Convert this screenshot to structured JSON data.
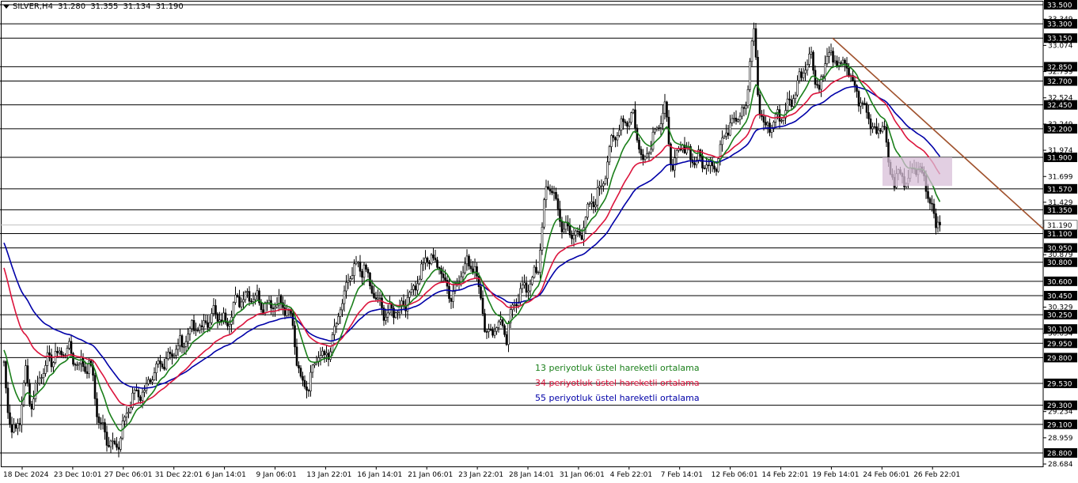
{
  "header": {
    "symbol": "SILVER,H4",
    "open": "31.280",
    "high": "31.355",
    "low": "31.134",
    "close": "31.190"
  },
  "legend": {
    "ema13": "13 periyotluk üstel hareketli ortalama",
    "ema34": "34 periyotluk üstel hareketli ortalama",
    "ema55": "55 periyotluk üstel hareketli ortalama"
  },
  "colors": {
    "ema13": "#1a7f1a",
    "ema34": "#dc143c",
    "ema55": "#0000a8",
    "trendline": "#a0522d",
    "zone": "#d8bfd8",
    "candle": "#000000",
    "level": "#000000",
    "current": "#c0c0c0"
  },
  "chart_data": {
    "type": "candlestick",
    "ylim": [
      28.684,
      33.5
    ],
    "x_labels": [
      "18 Dec 2024",
      "23 Dec 10:01",
      "27 Dec 06:01",
      "31 Dec 22:01",
      "6 Jan 14:01",
      "9 Jan 06:01",
      "13 Jan 22:01",
      "16 Jan 14:01",
      "21 Jan 06:01",
      "23 Jan 22:01",
      "28 Jan 14:01",
      "31 Jan 06:01",
      "4 Feb 22:01",
      "7 Feb 14:01",
      "12 Feb 06:01",
      "14 Feb 22:01",
      "19 Feb 14:01",
      "24 Feb 06:01",
      "26 Feb 22:01"
    ],
    "y_ticks": [
      "33.500",
      "33.349",
      "33.150",
      "33.074",
      "32.850",
      "32.799",
      "32.700",
      "32.524",
      "32.450",
      "32.249",
      "32.200",
      "31.974",
      "31.900",
      "31.699",
      "31.570",
      "31.429",
      "31.350",
      "31.190",
      "31.100",
      "30.950",
      "30.879",
      "30.800",
      "30.600",
      "30.450",
      "30.329",
      "30.250",
      "30.100",
      "30.054",
      "29.950",
      "29.800",
      "29.530",
      "29.300",
      "29.234",
      "29.100",
      "28.959",
      "28.800",
      "28.684"
    ],
    "levels": [
      33.5,
      33.3,
      33.15,
      32.85,
      32.7,
      32.45,
      32.2,
      31.9,
      31.57,
      31.35,
      31.1,
      30.95,
      30.8,
      30.6,
      30.45,
      30.25,
      30.1,
      29.95,
      29.8,
      29.53,
      29.3,
      29.1,
      28.8
    ],
    "level_labels": [
      "33.500",
      "33.300",
      "33.150",
      "32.850",
      "32.700",
      "32.450",
      "32.200",
      "31.900",
      "31.570",
      "31.350",
      "31.100",
      "30.950",
      "30.800",
      "30.600",
      "30.450",
      "30.250",
      "30.100",
      "29.950",
      "29.800",
      "29.530",
      "29.300",
      "29.100",
      "28.800"
    ],
    "current_price": 31.19,
    "current_label": "31.190",
    "anchors": [
      [
        0,
        30.15
      ],
      [
        8,
        29.4
      ],
      [
        15,
        28.95
      ],
      [
        25,
        29.15
      ],
      [
        32,
        29.7
      ],
      [
        40,
        29.35
      ],
      [
        50,
        29.6
      ],
      [
        65,
        29.75
      ],
      [
        85,
        29.95
      ],
      [
        100,
        29.7
      ],
      [
        115,
        29.65
      ],
      [
        125,
        29.15
      ],
      [
        140,
        28.95
      ],
      [
        150,
        28.85
      ],
      [
        158,
        29.1
      ],
      [
        168,
        29.4
      ],
      [
        180,
        29.5
      ],
      [
        195,
        29.6
      ],
      [
        210,
        29.75
      ],
      [
        225,
        29.95
      ],
      [
        240,
        30.1
      ],
      [
        255,
        30.05
      ],
      [
        270,
        30.3
      ],
      [
        285,
        30.2
      ],
      [
        300,
        30.35
      ],
      [
        320,
        30.5
      ],
      [
        340,
        30.35
      ],
      [
        360,
        30.3
      ],
      [
        370,
        30.2
      ],
      [
        378,
        29.65
      ],
      [
        390,
        29.5
      ],
      [
        400,
        29.75
      ],
      [
        415,
        29.85
      ],
      [
        430,
        30.35
      ],
      [
        445,
        30.65
      ],
      [
        460,
        30.75
      ],
      [
        475,
        30.45
      ],
      [
        490,
        30.2
      ],
      [
        505,
        30.3
      ],
      [
        520,
        30.55
      ],
      [
        540,
        30.8
      ],
      [
        555,
        30.75
      ],
      [
        570,
        30.5
      ],
      [
        585,
        30.7
      ],
      [
        600,
        30.75
      ],
      [
        615,
        30.1
      ],
      [
        630,
        30.15
      ],
      [
        640,
        29.95
      ],
      [
        650,
        30.4
      ],
      [
        665,
        30.6
      ],
      [
        680,
        30.7
      ],
      [
        690,
        31.55
      ],
      [
        700,
        31.5
      ],
      [
        712,
        31.2
      ],
      [
        725,
        31.1
      ],
      [
        735,
        31.05
      ],
      [
        745,
        31.35
      ],
      [
        760,
        31.65
      ],
      [
        770,
        32.0
      ],
      [
        785,
        32.2
      ],
      [
        800,
        32.35
      ],
      [
        812,
        31.9
      ],
      [
        825,
        32.1
      ],
      [
        840,
        32.35
      ],
      [
        850,
        31.8
      ],
      [
        862,
        32.1
      ],
      [
        875,
        31.85
      ],
      [
        890,
        31.8
      ],
      [
        905,
        31.9
      ],
      [
        915,
        32.15
      ],
      [
        930,
        32.3
      ],
      [
        942,
        32.4
      ],
      [
        948,
        33.0
      ],
      [
        952,
        33.3
      ],
      [
        958,
        32.55
      ],
      [
        966,
        32.2
      ],
      [
        975,
        32.2
      ],
      [
        990,
        32.35
      ],
      [
        1005,
        32.65
      ],
      [
        1015,
        32.85
      ],
      [
        1025,
        32.9
      ],
      [
        1035,
        32.55
      ],
      [
        1045,
        33.05
      ],
      [
        1052,
        32.95
      ],
      [
        1060,
        32.9
      ],
      [
        1068,
        32.85
      ],
      [
        1078,
        32.6
      ],
      [
        1090,
        32.45
      ],
      [
        1100,
        32.35
      ],
      [
        1108,
        32.15
      ],
      [
        1115,
        32.3
      ],
      [
        1122,
        31.8
      ],
      [
        1130,
        31.6
      ],
      [
        1138,
        31.75
      ],
      [
        1146,
        31.7
      ],
      [
        1155,
        31.85
      ],
      [
        1163,
        31.75
      ],
      [
        1170,
        31.6
      ],
      [
        1175,
        31.35
      ],
      [
        1182,
        31.25
      ],
      [
        1188,
        31.19
      ]
    ],
    "series": [
      {
        "name": "13 periyotluk üstel hareketli ortalama",
        "period": 13
      },
      {
        "name": "34 periyotluk üstel hareketli ortalama",
        "period": 34
      },
      {
        "name": "55 periyotluk üstel hareketli ortalama",
        "period": 55
      }
    ],
    "ema_start": {
      "ema13": 29.9,
      "ema34": 30.8,
      "ema55": 31.05
    },
    "trendline": {
      "start": {
        "x_index": 1052,
        "price": 33.15
      },
      "end": {
        "x_index": 1318,
        "price": 31.15
      }
    },
    "zone": {
      "x_start_index": 1115,
      "x_end_index": 1203,
      "price_top": 31.9,
      "price_bottom": 31.6
    }
  }
}
